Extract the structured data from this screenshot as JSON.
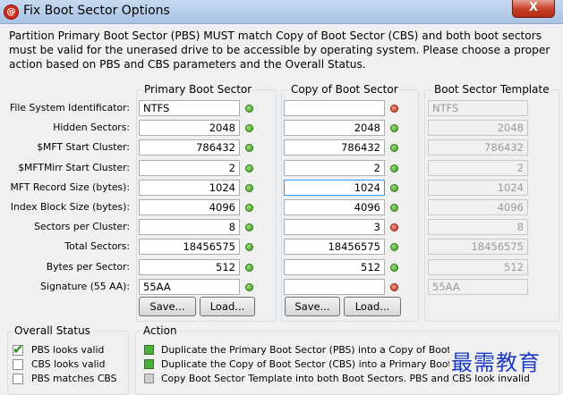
{
  "window": {
    "title": "Fix Boot Sector Options",
    "close_glyph": "X",
    "app_icon_glyph": "@"
  },
  "description": "Partition Primary Boot Sector (PBS) MUST match Copy of Boot Sector (CBS) and both boot sectors must be valid for the unerased drive to be accessible by operating system. Please choose a proper action based on PBS and CBS parameters and the Overall Status.",
  "columns": {
    "pbs_title": "Primary Boot Sector",
    "cbs_title": "Copy of Boot Sector",
    "template_title": "Boot Sector Template"
  },
  "fields": [
    {
      "label": "File System Identificator:",
      "pbs": "NTFS",
      "pbs_status": "green",
      "cbs": "",
      "cbs_status": "red",
      "template": "NTFS",
      "align": "left"
    },
    {
      "label": "Hidden Sectors:",
      "pbs": "2048",
      "pbs_status": "green",
      "cbs": "2048",
      "cbs_status": "green",
      "template": "2048",
      "align": "right"
    },
    {
      "label": "$MFT Start Cluster:",
      "pbs": "786432",
      "pbs_status": "green",
      "cbs": "786432",
      "cbs_status": "green",
      "template": "786432",
      "align": "right"
    },
    {
      "label": "$MFTMirr Start Cluster:",
      "pbs": "2",
      "pbs_status": "green",
      "cbs": "2",
      "cbs_status": "green",
      "template": "2",
      "align": "right"
    },
    {
      "label": "MFT Record Size (bytes):",
      "pbs": "1024",
      "pbs_status": "green",
      "cbs": "1024",
      "cbs_status": "green",
      "template": "1024",
      "align": "right"
    },
    {
      "label": "Index Block Size (bytes):",
      "pbs": "4096",
      "pbs_status": "green",
      "cbs": "4096",
      "cbs_status": "green",
      "template": "4096",
      "align": "right"
    },
    {
      "label": "Sectors per Cluster:",
      "pbs": "8",
      "pbs_status": "green",
      "cbs": "3",
      "cbs_status": "red",
      "template": "8",
      "align": "right"
    },
    {
      "label": "Total Sectors:",
      "pbs": "18456575",
      "pbs_status": "green",
      "cbs": "18456575",
      "cbs_status": "green",
      "template": "18456575",
      "align": "right"
    },
    {
      "label": "Bytes per Sector:",
      "pbs": "512",
      "pbs_status": "green",
      "cbs": "512",
      "cbs_status": "green",
      "template": "512",
      "align": "right"
    },
    {
      "label": "Signature (55 AA):",
      "pbs": "55AA",
      "pbs_status": "green",
      "cbs": "",
      "cbs_status": "red",
      "template": "55AA",
      "align": "left"
    }
  ],
  "buttons": {
    "pbs_save": "Save...",
    "pbs_load": "Load...",
    "cbs_save": "Save...",
    "cbs_load": "Load..."
  },
  "overall_status": {
    "title": "Overall Status",
    "items": [
      {
        "label": "PBS looks valid",
        "checked": true
      },
      {
        "label": "CBS looks valid",
        "checked": false
      },
      {
        "label": "PBS matches CBS",
        "checked": false
      }
    ]
  },
  "action": {
    "title": "Action",
    "items": [
      {
        "label": "Duplicate the Primary Boot Sector (PBS) into a Copy of Boot Sector (C",
        "state": "green"
      },
      {
        "label": "Duplicate the Copy of Boot Sector (CBS) into a Primary Boot Sector (",
        "state": "green"
      },
      {
        "label": "Copy Boot Sector Template into both Boot Sectors. PBS and CBS look invalid",
        "state": "gray"
      }
    ]
  },
  "watermark": "最需教育",
  "colors": {
    "status_green": "#3c9a1d",
    "status_red": "#c7321f",
    "focus_border": "#3399ff"
  }
}
